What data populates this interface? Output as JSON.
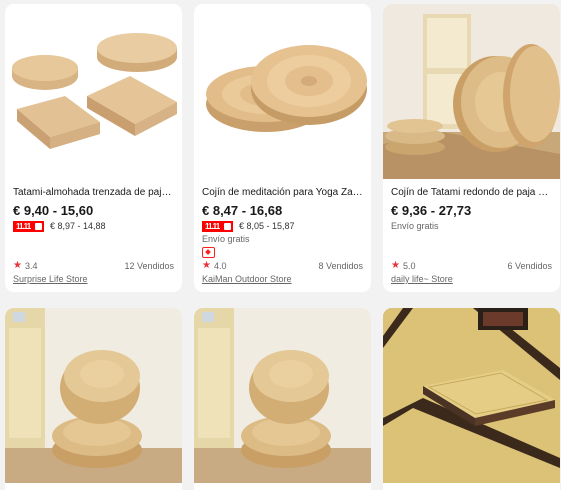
{
  "products": [
    {
      "title": "Tatami-almohada trenzada de paja para asiento",
      "price": "€ 9,40 - 15,60",
      "sale_price": "€ 8,97 - 14,88",
      "shipping": "",
      "rating": "3.4",
      "sold": "12 Vendidos",
      "store": "Surprise Life Store"
    },
    {
      "title": "Cojín de meditación para Yoga Zafu de paja",
      "price": "€ 8,47 - 16,68",
      "sale_price": "€ 8,05 - 15,87",
      "shipping": "Envío gratis",
      "rating": "4.0",
      "sold": "8 Vendidos",
      "store": "KaiMan Outdoor Store"
    },
    {
      "title": "Cojín de Tatami redondo de paja Natural",
      "price": "€ 9,36 - 27,73",
      "sale_price": "",
      "shipping": "Envío gratis",
      "rating": "5.0",
      "sold": "6 Vendidos",
      "store": "daily life~ Store"
    },
    {
      "title": "",
      "price": "",
      "sale_price": "",
      "shipping": "",
      "rating": "",
      "sold": "",
      "store": ""
    },
    {
      "title": "",
      "price": "",
      "sale_price": "",
      "shipping": "",
      "rating": "",
      "sold": "",
      "store": ""
    },
    {
      "title": "",
      "price": "",
      "sale_price": "",
      "shipping": "",
      "rating": "",
      "sold": "",
      "store": ""
    }
  ],
  "colors": {
    "price": "#191919",
    "accent": "#ff0000",
    "star": "#e9333a",
    "background": "#f2f2f2"
  },
  "icons": {
    "rating": "star-icon",
    "sale": "sale-badge-icon",
    "choice": "choice-badge-icon"
  }
}
